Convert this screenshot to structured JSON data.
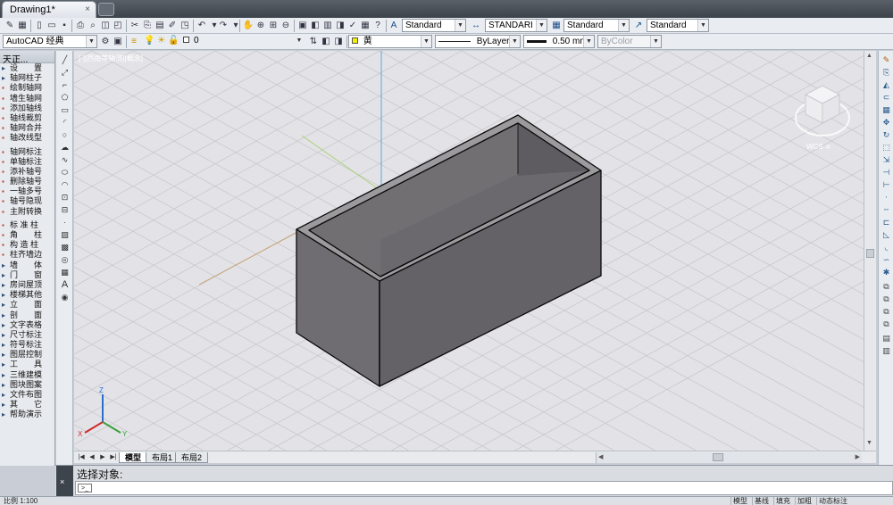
{
  "titlebar": {
    "doc_tab": "Drawing1*",
    "close_glyph": "×"
  },
  "toolbar1": {
    "styles": [
      {
        "value": "Standard",
        "icon": "text-style-icon"
      },
      {
        "value": "STANDARI",
        "icon": "dim-style-icon"
      },
      {
        "value": "Standard",
        "icon": "table-style-icon"
      },
      {
        "value": "Standard",
        "icon": "multileader-style-icon"
      }
    ]
  },
  "toolbar2": {
    "workspace": "AutoCAD 经典",
    "layer": "0",
    "color": "黄",
    "linetype": "ByLayer",
    "lineweight": "0.50 mm",
    "plotstyle": "ByColor"
  },
  "left_panel": {
    "title": "天正...",
    "items": [
      {
        "label": "设　　置",
        "type": "cat"
      },
      {
        "label": "轴网柱子",
        "type": "cat"
      },
      {
        "label": "绘制轴网",
        "type": "icon"
      },
      {
        "label": "墙生轴网",
        "type": "icon"
      },
      {
        "label": "添加轴线",
        "type": "icon"
      },
      {
        "label": "轴线裁剪",
        "type": "icon"
      },
      {
        "label": "轴网合并",
        "type": "icon"
      },
      {
        "label": "轴改线型",
        "type": "icon"
      },
      {
        "label": "",
        "type": "gap"
      },
      {
        "label": "轴网标注",
        "type": "icon"
      },
      {
        "label": "单轴标注",
        "type": "icon"
      },
      {
        "label": "添补轴号",
        "type": "icon"
      },
      {
        "label": "删除轴号",
        "type": "icon"
      },
      {
        "label": "一轴多号",
        "type": "icon"
      },
      {
        "label": "轴号隐现",
        "type": "icon"
      },
      {
        "label": "主附转换",
        "type": "icon"
      },
      {
        "label": "",
        "type": "gap"
      },
      {
        "label": "标 准 柱",
        "type": "icon"
      },
      {
        "label": "角　　柱",
        "type": "icon"
      },
      {
        "label": "构 造 柱",
        "type": "icon"
      },
      {
        "label": "柱齐墙边",
        "type": "icon"
      },
      {
        "label": "墙　　体",
        "type": "cat"
      },
      {
        "label": "门　　窗",
        "type": "cat"
      },
      {
        "label": "房间屋顶",
        "type": "cat"
      },
      {
        "label": "楼梯其他",
        "type": "cat"
      },
      {
        "label": "立　　面",
        "type": "cat"
      },
      {
        "label": "剖　　面",
        "type": "cat"
      },
      {
        "label": "文字表格",
        "type": "cat"
      },
      {
        "label": "尺寸标注",
        "type": "cat"
      },
      {
        "label": "符号标注",
        "type": "cat"
      },
      {
        "label": "图层控制",
        "type": "cat"
      },
      {
        "label": "工　　具",
        "type": "cat"
      },
      {
        "label": "三维建模",
        "type": "cat"
      },
      {
        "label": "图块图案",
        "type": "cat"
      },
      {
        "label": "文件布图",
        "type": "cat"
      },
      {
        "label": "其　　它",
        "type": "cat"
      },
      {
        "label": "帮助演示",
        "type": "cat"
      }
    ]
  },
  "viewport": {
    "label": "[-][西南等轴测][概念]",
    "wcs": "WCS ≑"
  },
  "layout_tabs": [
    "模型",
    "布局1",
    "布局2"
  ],
  "command": {
    "prompt": "选择对象:",
    "close_glyph": "×",
    "icon": "command-prompt-icon",
    "input_value": ""
  },
  "status_bar": {
    "scale": "比例 1:100",
    "buttons": [
      "模型",
      "基线",
      "填充",
      "加粗",
      "动态标注"
    ]
  },
  "colors": {
    "viewport_bg": "#e3e3e7",
    "box_face": "#6c6a6e",
    "box_face_dark": "#5e5c60",
    "box_rim": "#9a989b",
    "axis_x": "#c8a070",
    "axis_y": "#a8d070",
    "axis_z": "#5aa8d8"
  }
}
